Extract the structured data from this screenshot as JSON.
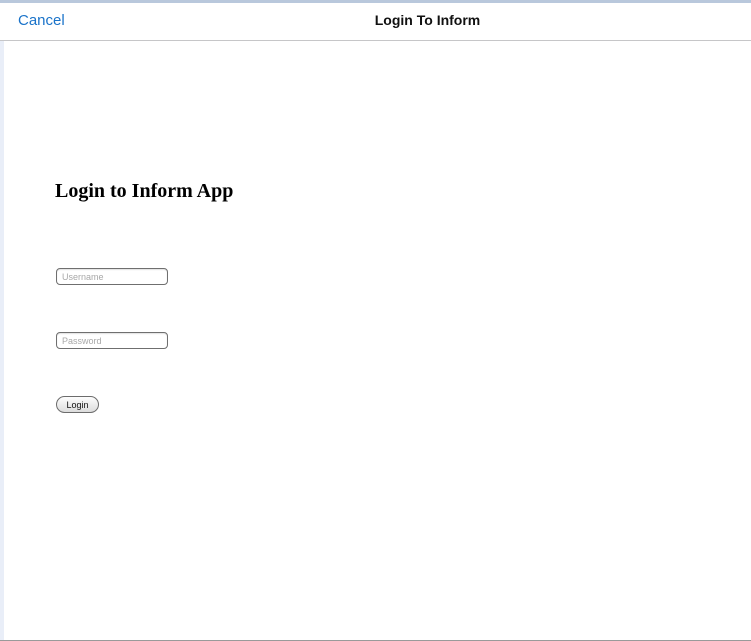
{
  "navbar": {
    "cancel_label": "Cancel",
    "title": "Login To Inform"
  },
  "form": {
    "heading": "Login to Inform App",
    "username": {
      "value": "",
      "placeholder": "Username"
    },
    "password": {
      "value": "",
      "placeholder": "Password"
    },
    "login_label": "Login"
  },
  "colors": {
    "accent": "#1a73c9",
    "title_text": "#111111",
    "border": "#c6c6c8"
  }
}
